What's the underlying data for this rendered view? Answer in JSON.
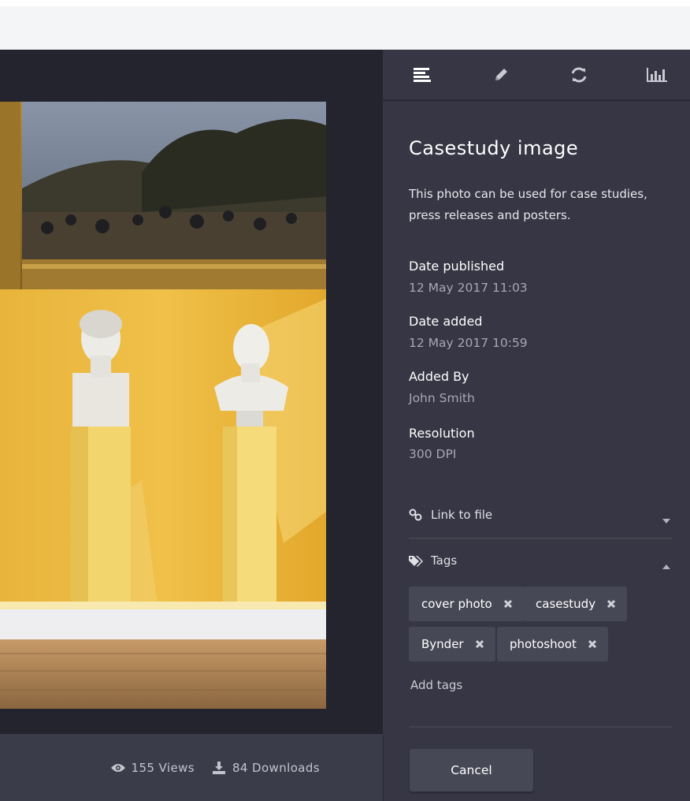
{
  "tabs": [
    {
      "icon": "details-icon",
      "active": true
    },
    {
      "icon": "pencil-icon"
    },
    {
      "icon": "refresh-icon"
    },
    {
      "icon": "bar-chart-icon"
    }
  ],
  "asset": {
    "title": "Casestudy image",
    "description": "This photo can be used for case studies, press releases and posters.",
    "meta": [
      {
        "label": "Date published",
        "value": "12 May  2017 11:03"
      },
      {
        "label": "Date added",
        "value": "12 May  2017 10:59"
      },
      {
        "label": "Added By",
        "value": "John Smith"
      },
      {
        "label": "Resolution",
        "value": "300 DPI"
      }
    ]
  },
  "link_section": {
    "label": "Link to file",
    "icon": "link-icon",
    "expanded": false
  },
  "tags_section": {
    "label": "Tags",
    "icon": "tags-icon",
    "expanded": true,
    "tags": [
      "cover photo",
      "casestudy",
      "Bynder",
      "photoshoot"
    ],
    "add_label": "Add tags"
  },
  "stats": {
    "views": "155 Views",
    "downloads": "84 Downloads"
  },
  "footer": {
    "cancel_label": "Cancel"
  },
  "colors": {
    "background": "#24242e",
    "panel": "#363644",
    "tag": "#474856"
  }
}
